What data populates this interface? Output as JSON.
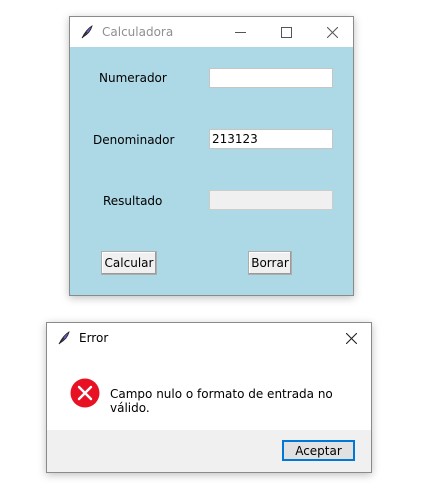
{
  "calculator_window": {
    "title": "Calculadora",
    "numerator_label": "Numerador",
    "numerator_value": "",
    "denominator_label": "Denominador",
    "denominator_value": "213123",
    "result_label": "Resultado",
    "result_value": "",
    "calculate_button": "Calcular",
    "clear_button": "Borrar",
    "background_color": "#add8e6"
  },
  "error_dialog": {
    "title": "Error",
    "message": "Campo nulo o formato de entrada no válido.",
    "accept_button": "Aceptar",
    "icon": "error-icon",
    "accent_color": "#0078d7"
  }
}
